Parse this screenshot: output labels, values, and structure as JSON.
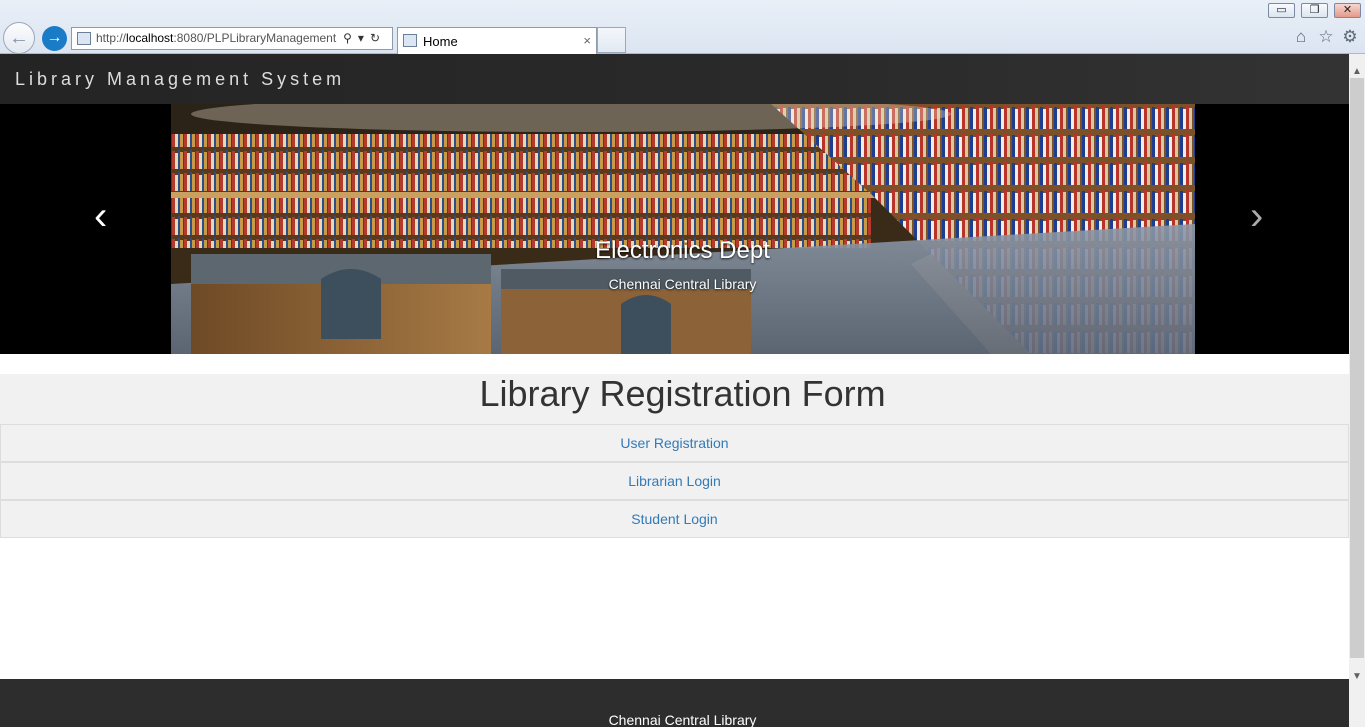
{
  "browser": {
    "address": {
      "url_prefix": "http://",
      "url_host": "localhost",
      "url_rest": ":8080/PLPLibraryManagement"
    },
    "tab": {
      "title": "Home",
      "close": "×"
    },
    "window_controls": [
      "▭",
      "❐",
      "✕"
    ],
    "toolbar_icons": [
      "home-icon",
      "star-icon",
      "gear-icon"
    ]
  },
  "navbar": {
    "brand": "Library Management System"
  },
  "carousel": {
    "caption_title": "Electronics Dept",
    "caption_subtitle": "Chennai Central Library",
    "prev": "‹",
    "next": "›"
  },
  "main": {
    "title": "Library Registration Form",
    "links": [
      {
        "label": "User Registration"
      },
      {
        "label": "Librarian Login"
      },
      {
        "label": "Student Login"
      }
    ]
  },
  "footer": {
    "text": "Chennai Central Library"
  }
}
